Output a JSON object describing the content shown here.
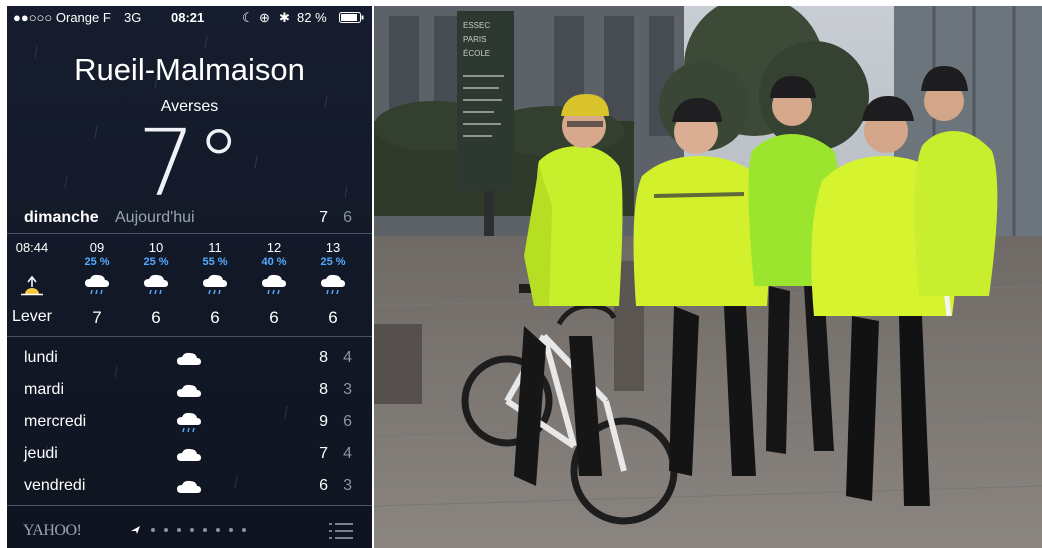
{
  "status_bar": {
    "carrier": "●●○○○ Orange F",
    "network": "3G",
    "time": "08:21",
    "battery": "82 %"
  },
  "weather": {
    "city": "Rueil-Malmaison",
    "condition": "Averses",
    "temperature": "7°",
    "day": "dimanche",
    "today": "Aujourd'hui",
    "high": "7",
    "low": "6",
    "hourly": [
      {
        "time": "08:44",
        "precip": "",
        "icon": "sunrise-icon",
        "value": "Lever"
      },
      {
        "time": "09",
        "precip": "25 %",
        "icon": "rain-cloud-icon",
        "value": "7"
      },
      {
        "time": "10",
        "precip": "25 %",
        "icon": "rain-cloud-icon",
        "value": "6"
      },
      {
        "time": "11",
        "precip": "55 %",
        "icon": "rain-cloud-icon",
        "value": "6"
      },
      {
        "time": "12",
        "precip": "40 %",
        "icon": "rain-cloud-icon",
        "value": "6"
      },
      {
        "time": "13",
        "precip": "25 %",
        "icon": "rain-cloud-icon",
        "value": "6"
      }
    ],
    "forecast": [
      {
        "day": "lundi",
        "icon": "cloud-icon",
        "high": "8",
        "low": "4"
      },
      {
        "day": "mardi",
        "icon": "cloud-icon",
        "high": "8",
        "low": "3"
      },
      {
        "day": "mercredi",
        "icon": "rain-cloud-icon",
        "high": "9",
        "low": "6"
      },
      {
        "day": "jeudi",
        "icon": "cloud-icon",
        "high": "7",
        "low": "4"
      },
      {
        "day": "vendredi",
        "icon": "cloud-icon",
        "high": "6",
        "low": "3"
      }
    ],
    "provider": "YAHOO!",
    "accent_color": "#55aaff"
  },
  "photo": {
    "sign_lines": [
      "ESSEC",
      "PARIS",
      "ÉCOLE"
    ]
  }
}
